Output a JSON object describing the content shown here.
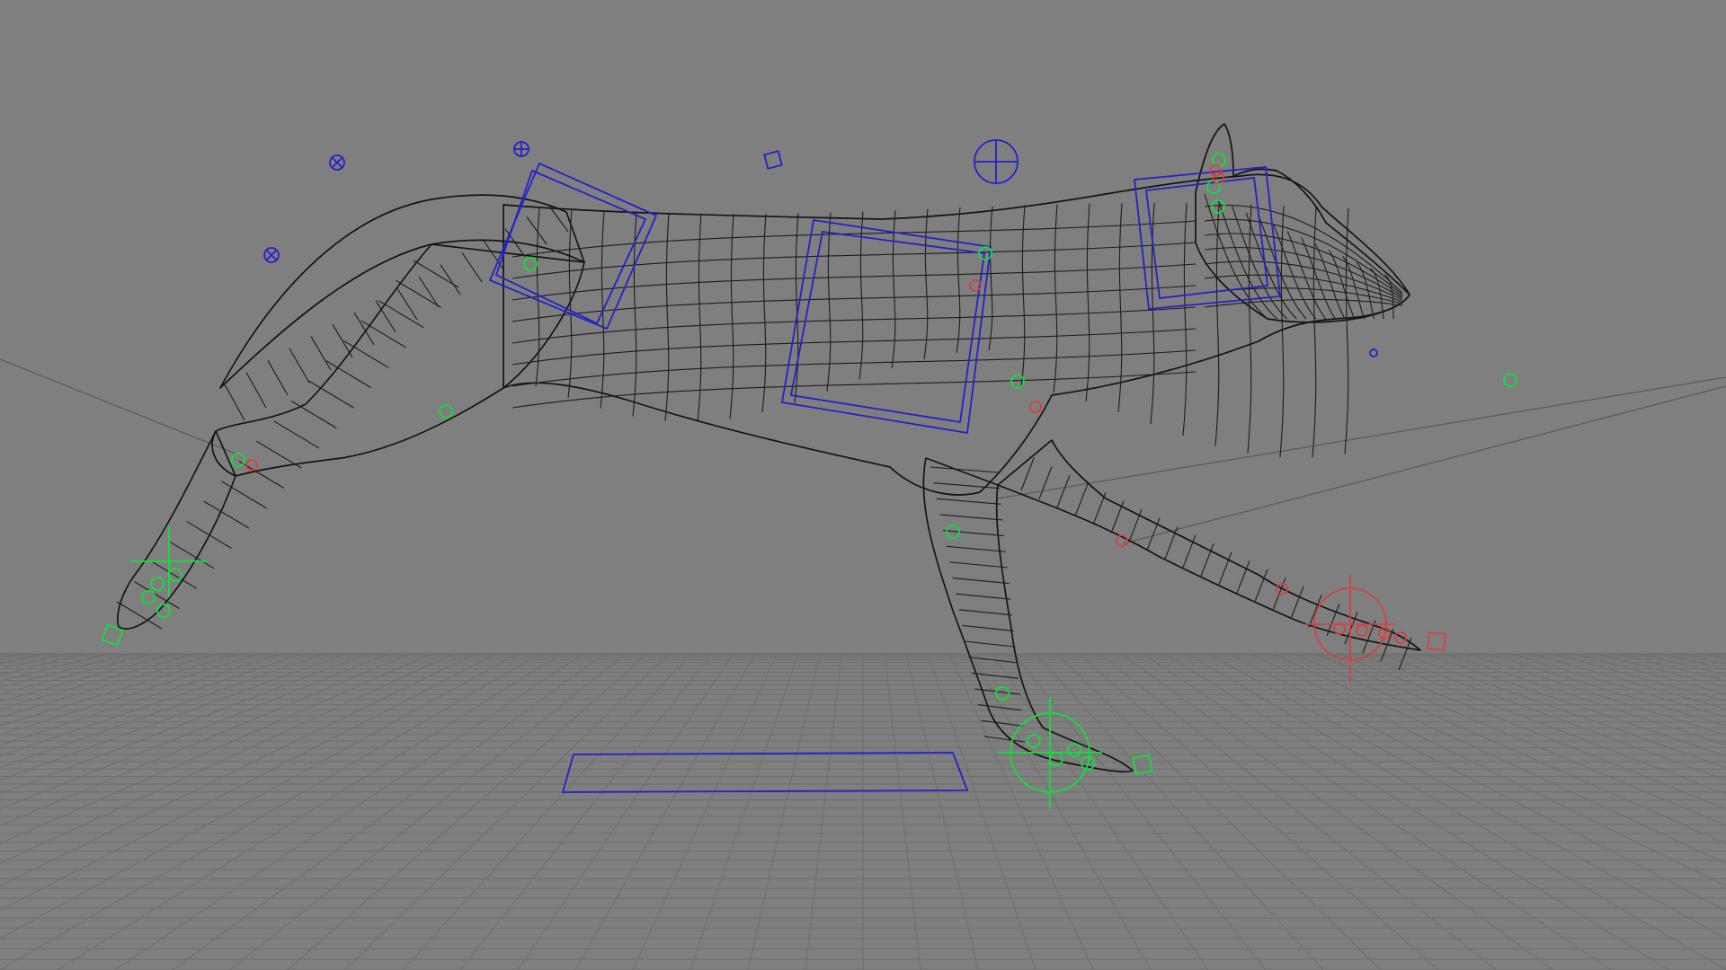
{
  "viewport": {
    "background": "#7f7f7f",
    "grid_color": "#6e6e6e",
    "wireframe_color": "#141414"
  },
  "rig": {
    "blue_controls_color": "#2222c8",
    "green_controls_color": "#11e03a",
    "red_controls_color": "#e03a3a"
  }
}
